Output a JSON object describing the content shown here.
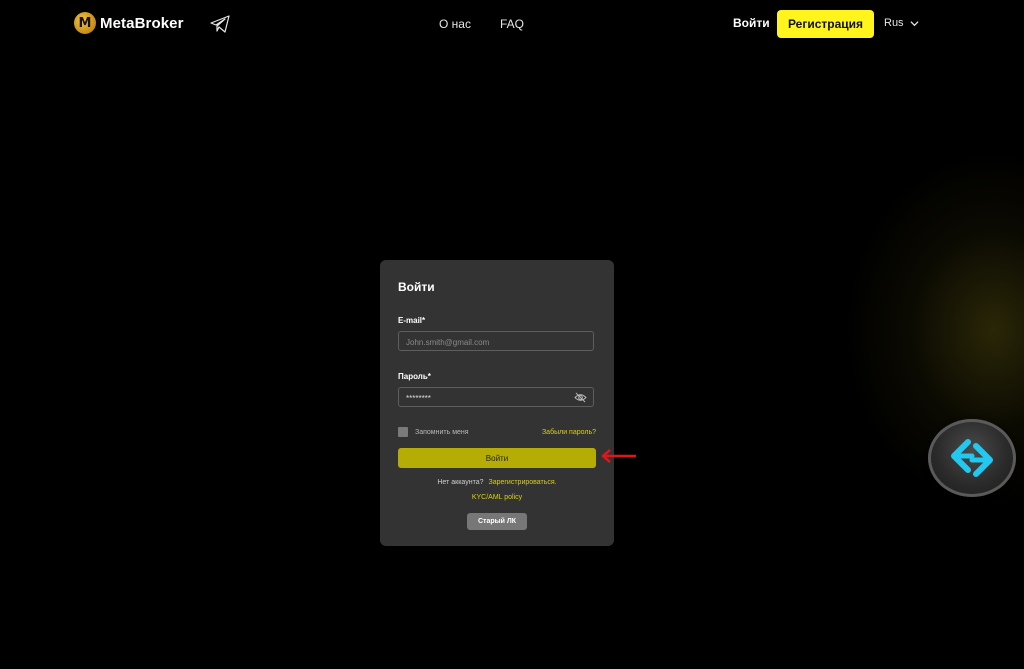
{
  "header": {
    "logo_letter": "M",
    "logo_text": "MetaBroker",
    "nav": [
      {
        "label": "О нас"
      },
      {
        "label": "FAQ"
      }
    ],
    "login_label": "Войти",
    "register_label": "Регистрация",
    "language": "Rus"
  },
  "login_card": {
    "title": "Войти",
    "email_label": "E-mail*",
    "email_placeholder": "John.smith@gmail.com",
    "email_value": "",
    "password_label": "Пароль*",
    "password_value": "********",
    "remember_label": "Запомнить меня",
    "remember_checked": false,
    "forgot_label": "Забыли пароль?",
    "submit_label": "Войти",
    "no_account_text": "Нет аккаунта?",
    "register_link": "Зарегистрироваться.",
    "kyc_link": "KYC/AML policy",
    "old_cabinet_label": "Старый ЛК"
  },
  "colors": {
    "accent": "#fff51c",
    "button": "#b5ad05",
    "card_bg": "#333333",
    "link": "#d8cf1a",
    "arrow": "#e0161a",
    "widget_icon": "#22c8f0"
  },
  "icons": {
    "telegram": "telegram-icon",
    "eye": "eye-off-icon",
    "chevron": "chevron-down-icon",
    "arrow": "arrow-left-icon",
    "widget": "exchange-arrows-icon"
  }
}
